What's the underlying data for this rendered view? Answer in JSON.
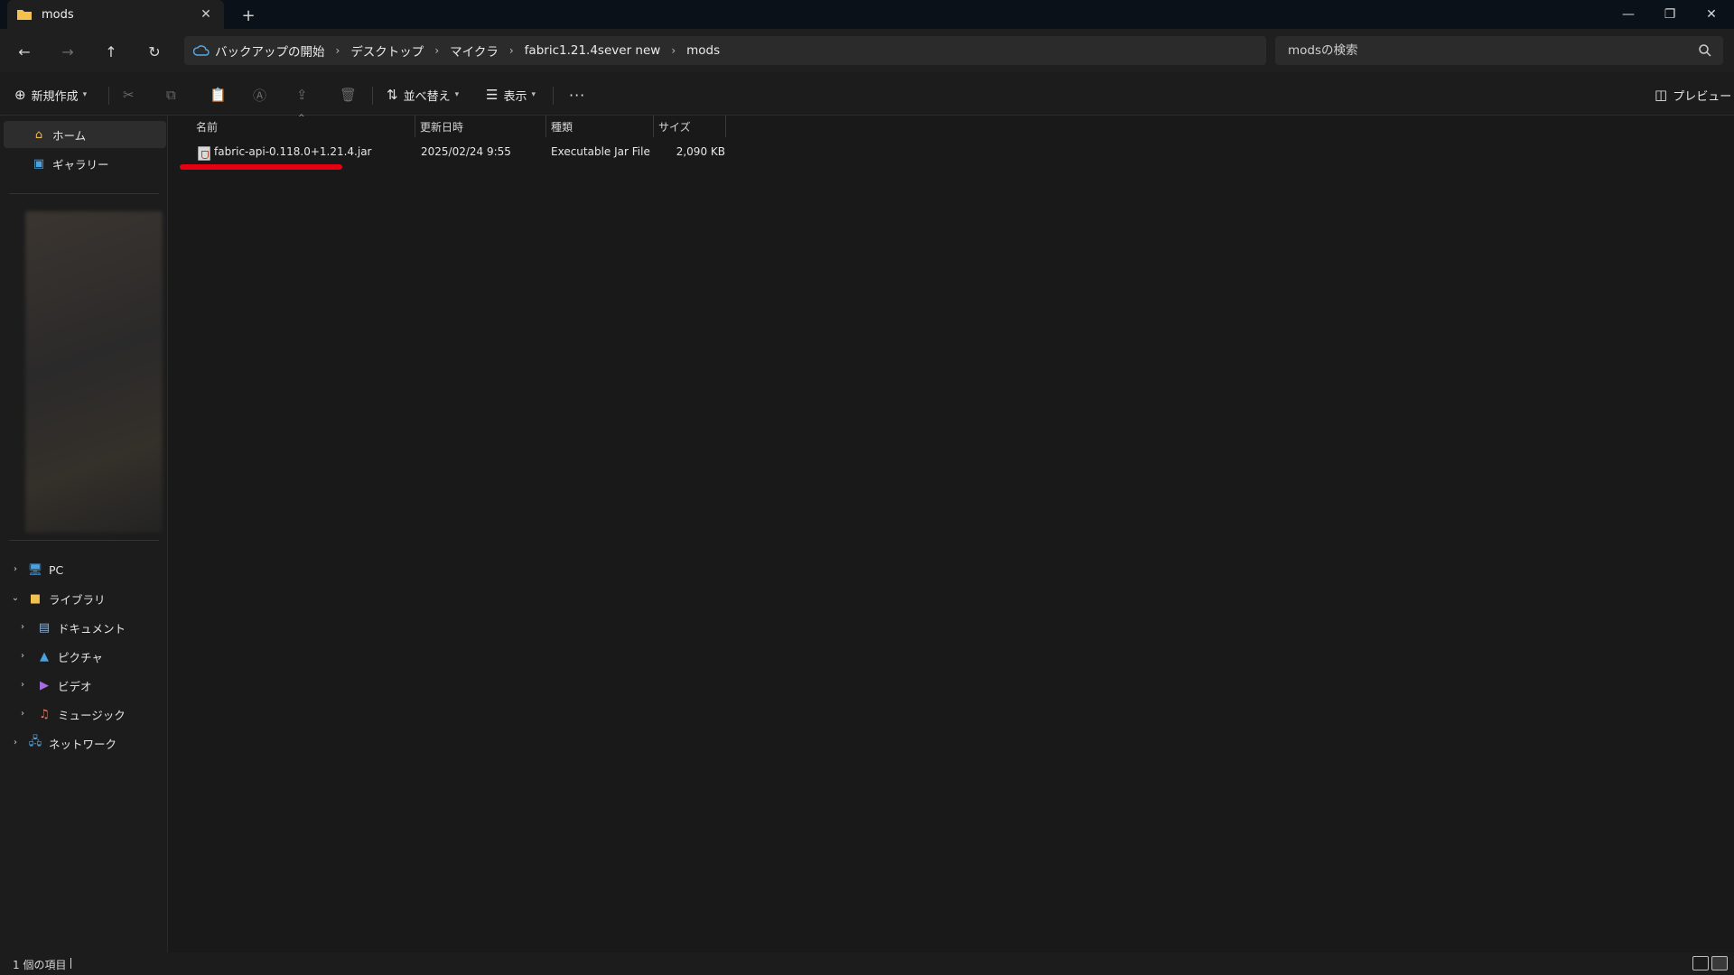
{
  "window": {
    "tab_title": "mods",
    "new_tab": "+",
    "close_tab": "✕",
    "minimize": "—",
    "restore": "❐",
    "close": "✕"
  },
  "nav": {
    "back": "←",
    "forward": "→",
    "up": "↑",
    "refresh": "↻"
  },
  "breadcrumb": {
    "items": [
      "バックアップの開始",
      "デスクトップ",
      "マイクラ",
      "fabric1.21.4sever new",
      "mods"
    ],
    "separator": "›"
  },
  "search": {
    "placeholder": "modsの検索"
  },
  "toolbar": {
    "new_label": "新規作成",
    "sort_label": "並べ替え",
    "view_label": "表示",
    "more_label": "···",
    "preview_label": "プレビュー"
  },
  "sidebar": {
    "top_items": [
      {
        "label": "ホーム",
        "icon": "home-icon"
      },
      {
        "label": "ギャラリー",
        "icon": "gallery-icon"
      }
    ],
    "tree": [
      {
        "label": "PC",
        "icon": "pc-icon",
        "expanded": false
      },
      {
        "label": "ライブラリ",
        "icon": "library-folder-icon",
        "expanded": true
      },
      {
        "label": "ドキュメント",
        "icon": "documents-icon",
        "expanded": false
      },
      {
        "label": "ピクチャ",
        "icon": "pictures-icon",
        "expanded": false
      },
      {
        "label": "ビデオ",
        "icon": "videos-icon",
        "expanded": false
      },
      {
        "label": "ミュージック",
        "icon": "music-icon",
        "expanded": false
      },
      {
        "label": "ネットワーク",
        "icon": "network-icon",
        "expanded": false
      }
    ]
  },
  "columns": {
    "name": "名前",
    "modified": "更新日時",
    "type": "種類",
    "size": "サイズ"
  },
  "files": [
    {
      "name": "fabric-api-0.118.0+1.21.4.jar",
      "modified": "2025/02/24 9:55",
      "type": "Executable Jar File",
      "size": "2,090 KB"
    }
  ],
  "status": {
    "item_count": "1 個の項目"
  },
  "colors": {
    "highlight_underline": "#e60012",
    "folder_yellow": "#f2c14e"
  }
}
